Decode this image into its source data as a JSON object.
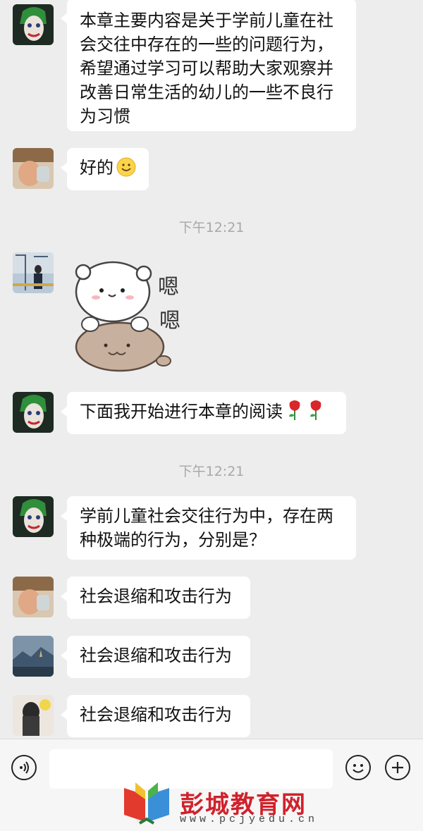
{
  "messages": {
    "m1": "本章主要内容是关于学前儿童在社会交往中存在的一些的问题行为，希望通过学习可以帮助大家观察并改善日常生活的幼儿的一些不良行为习惯",
    "m2": "好的",
    "m3_sticker_text_1": "嗯",
    "m3_sticker_text_2": "嗯",
    "m4": "下面我开始进行本章的阅读",
    "m5": "学前儿童社会交往行为中，存在两种极端的行为，分别是？",
    "m6": "社会退缩和攻击行为",
    "m7": "社会退缩和攻击行为",
    "m8": "社会退缩和攻击行为"
  },
  "timestamps": {
    "t1": "下午12:21",
    "t2": "下午12:21"
  },
  "icons": {
    "voice": "voice-icon",
    "emoji": "emoji-icon",
    "plus": "plus-icon"
  },
  "watermark": {
    "name": "彭城教育网",
    "url": "www.pcjyedu.cn"
  },
  "colors": {
    "background": "#ededed",
    "bubble": "#ffffff",
    "time": "#a8a8a8",
    "brand": "#d0212b"
  }
}
